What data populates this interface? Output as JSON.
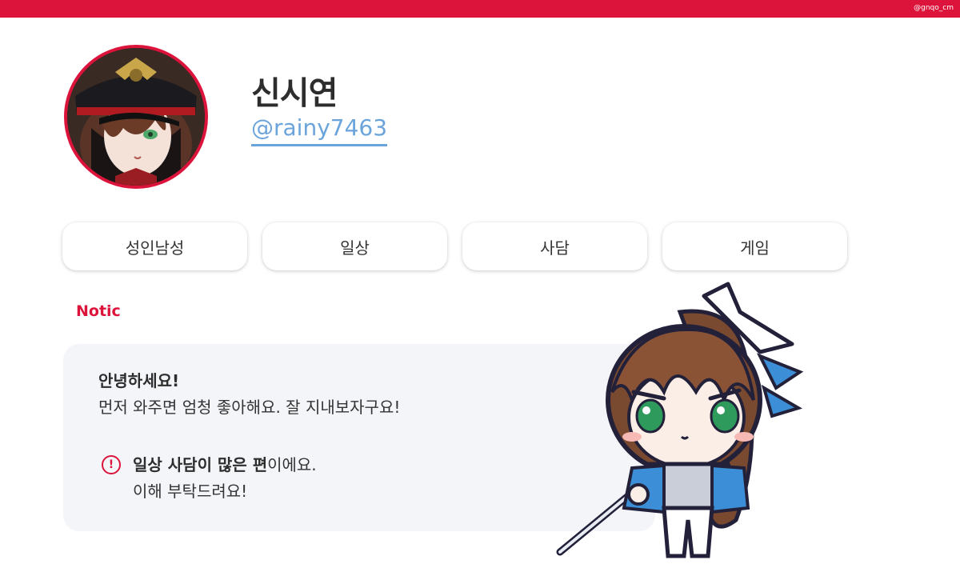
{
  "watermark": "@gnqo_cm",
  "profile": {
    "display_name": "신시연",
    "handle": "@rainy7463"
  },
  "tags": [
    "성인남성",
    "일상",
    "사담",
    "게임"
  ],
  "notice": {
    "title": "Notic",
    "greeting": "안녕하세요!",
    "line2": "먼저 와주면 엄청 좋아해요. 잘 지내보자구요!",
    "warning_bold_1": "일상 사담이 많은 편",
    "warning_rest_1": "이에요.",
    "warning_line_2": "이해 부탁드려요!",
    "warning_icon": "!"
  },
  "colors": {
    "accent": "#dc143c",
    "handle": "#6aa4db",
    "notice_bg": "#f3f5f9"
  },
  "icons": {
    "warning": "exclamation-circle-icon"
  }
}
